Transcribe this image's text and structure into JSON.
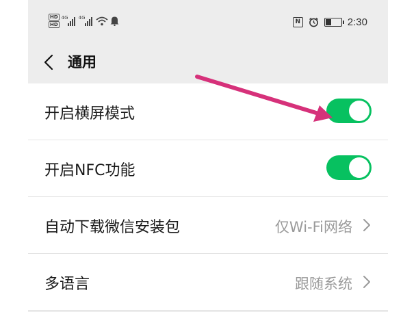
{
  "status_bar": {
    "hd_1": "HD",
    "hd_2": "HD",
    "network_1": "4G",
    "network_2": "4G",
    "time": "2:30",
    "icons": [
      "hd-icon",
      "signal-icon",
      "signal-icon",
      "wifi-icon",
      "bell-icon",
      "nfc-icon",
      "alarm-icon",
      "battery-icon"
    ]
  },
  "navbar": {
    "title": "通用",
    "back_icon": "chevron-left-icon"
  },
  "settings": [
    {
      "label": "开启横屏模式",
      "type": "toggle",
      "on": true
    },
    {
      "label": "开启NFC功能",
      "type": "toggle",
      "on": true
    },
    {
      "label": "自动下载微信安装包",
      "type": "select",
      "value": "仅Wi-Fi网络"
    },
    {
      "label": "多语言",
      "type": "select",
      "value": "跟随系统"
    }
  ],
  "colors": {
    "toggle_on": "#07c160",
    "annotation_arrow": "#d6317a",
    "page_bg": "#ededed"
  }
}
